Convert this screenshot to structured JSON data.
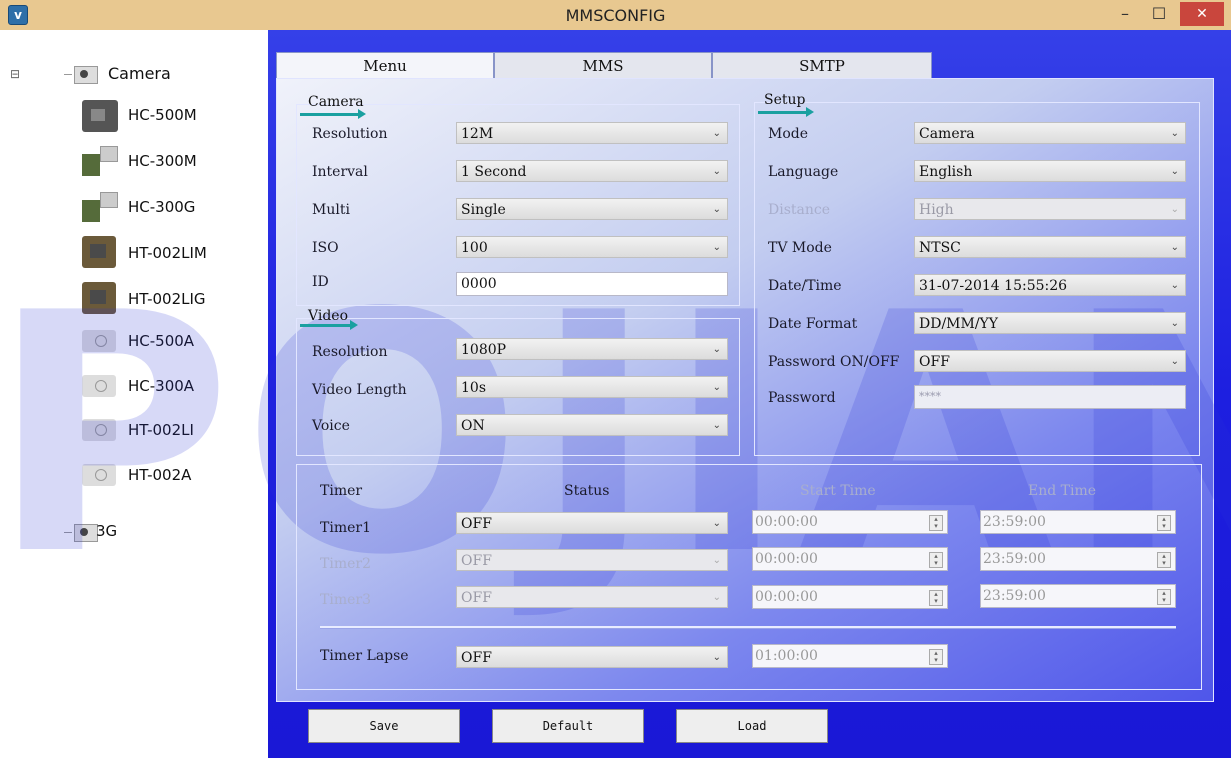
{
  "window": {
    "title": "MMSCONFIG",
    "app_icon": "ᴠ",
    "minimize": "–",
    "maximize": "☐",
    "close": "✕"
  },
  "sidebar": {
    "collapse": "⊟",
    "root_label": "Camera",
    "items": [
      {
        "label": "HC-500M",
        "icon": "dark-camera"
      },
      {
        "label": "HC-300M",
        "icon": "kit-camera"
      },
      {
        "label": "HC-300G",
        "icon": "kit-camera"
      },
      {
        "label": "HT-002LIM",
        "icon": "camo-camera"
      },
      {
        "label": "HT-002LIG",
        "icon": "camo-camera"
      },
      {
        "label": "HC-500A",
        "icon": "generic-camera"
      },
      {
        "label": "HC-300A",
        "icon": "generic-camera"
      },
      {
        "label": "HT-002LI",
        "icon": "generic-camera"
      },
      {
        "label": "HT-002A",
        "icon": "generic-camera"
      }
    ],
    "root2_label": "3G"
  },
  "tabs": [
    "Menu",
    "MMS",
    "SMTP"
  ],
  "camera": {
    "title": "Camera",
    "resolution_label": "Resolution",
    "resolution": "12M",
    "interval_label": "Interval",
    "interval": "1 Second",
    "multi_label": "Multi",
    "multi": "Single",
    "iso_label": "ISO",
    "iso": "100",
    "id_label": "ID",
    "id": "0000"
  },
  "video": {
    "title": "Video",
    "resolution_label": "Resolution",
    "resolution": "1080P",
    "length_label": "Video Length",
    "length": "10s",
    "voice_label": "Voice",
    "voice": "ON"
  },
  "setup": {
    "title": "Setup",
    "mode_label": "Mode",
    "mode": "Camera",
    "language_label": "Language",
    "language": "English",
    "distance_label": "Distance",
    "distance": "High",
    "tvmode_label": "TV Mode",
    "tvmode": "NTSC",
    "datetime_label": "Date/Time",
    "datetime": "31-07-2014 15:55:26",
    "dateformat_label": "Date Format",
    "dateformat": "DD/MM/YY",
    "password_onoff_label": "Password ON/OFF",
    "password_onoff": "OFF",
    "password_label": "Password",
    "password": "****"
  },
  "timers": {
    "col_timer": "Timer",
    "col_status": "Status",
    "col_start": "Start Time",
    "col_end": "End Time",
    "rows": [
      {
        "name": "Timer1",
        "status": "OFF",
        "start": "00:00:00",
        "end": "23:59:00"
      },
      {
        "name": "Timer2",
        "status": "OFF",
        "start": "00:00:00",
        "end": "23:59:00"
      },
      {
        "name": "Timer3",
        "status": "OFF",
        "start": "00:00:00",
        "end": "23:59:00"
      }
    ],
    "lapse_label": "Timer Lapse",
    "lapse": "OFF",
    "lapse_time": "01:00:00"
  },
  "buttons": {
    "save": "Save",
    "default": "Default",
    "load": "Load"
  },
  "watermark": "POJIAN",
  "glyphs": {
    "chevron": "❯",
    "spin": "▲\n▼"
  }
}
